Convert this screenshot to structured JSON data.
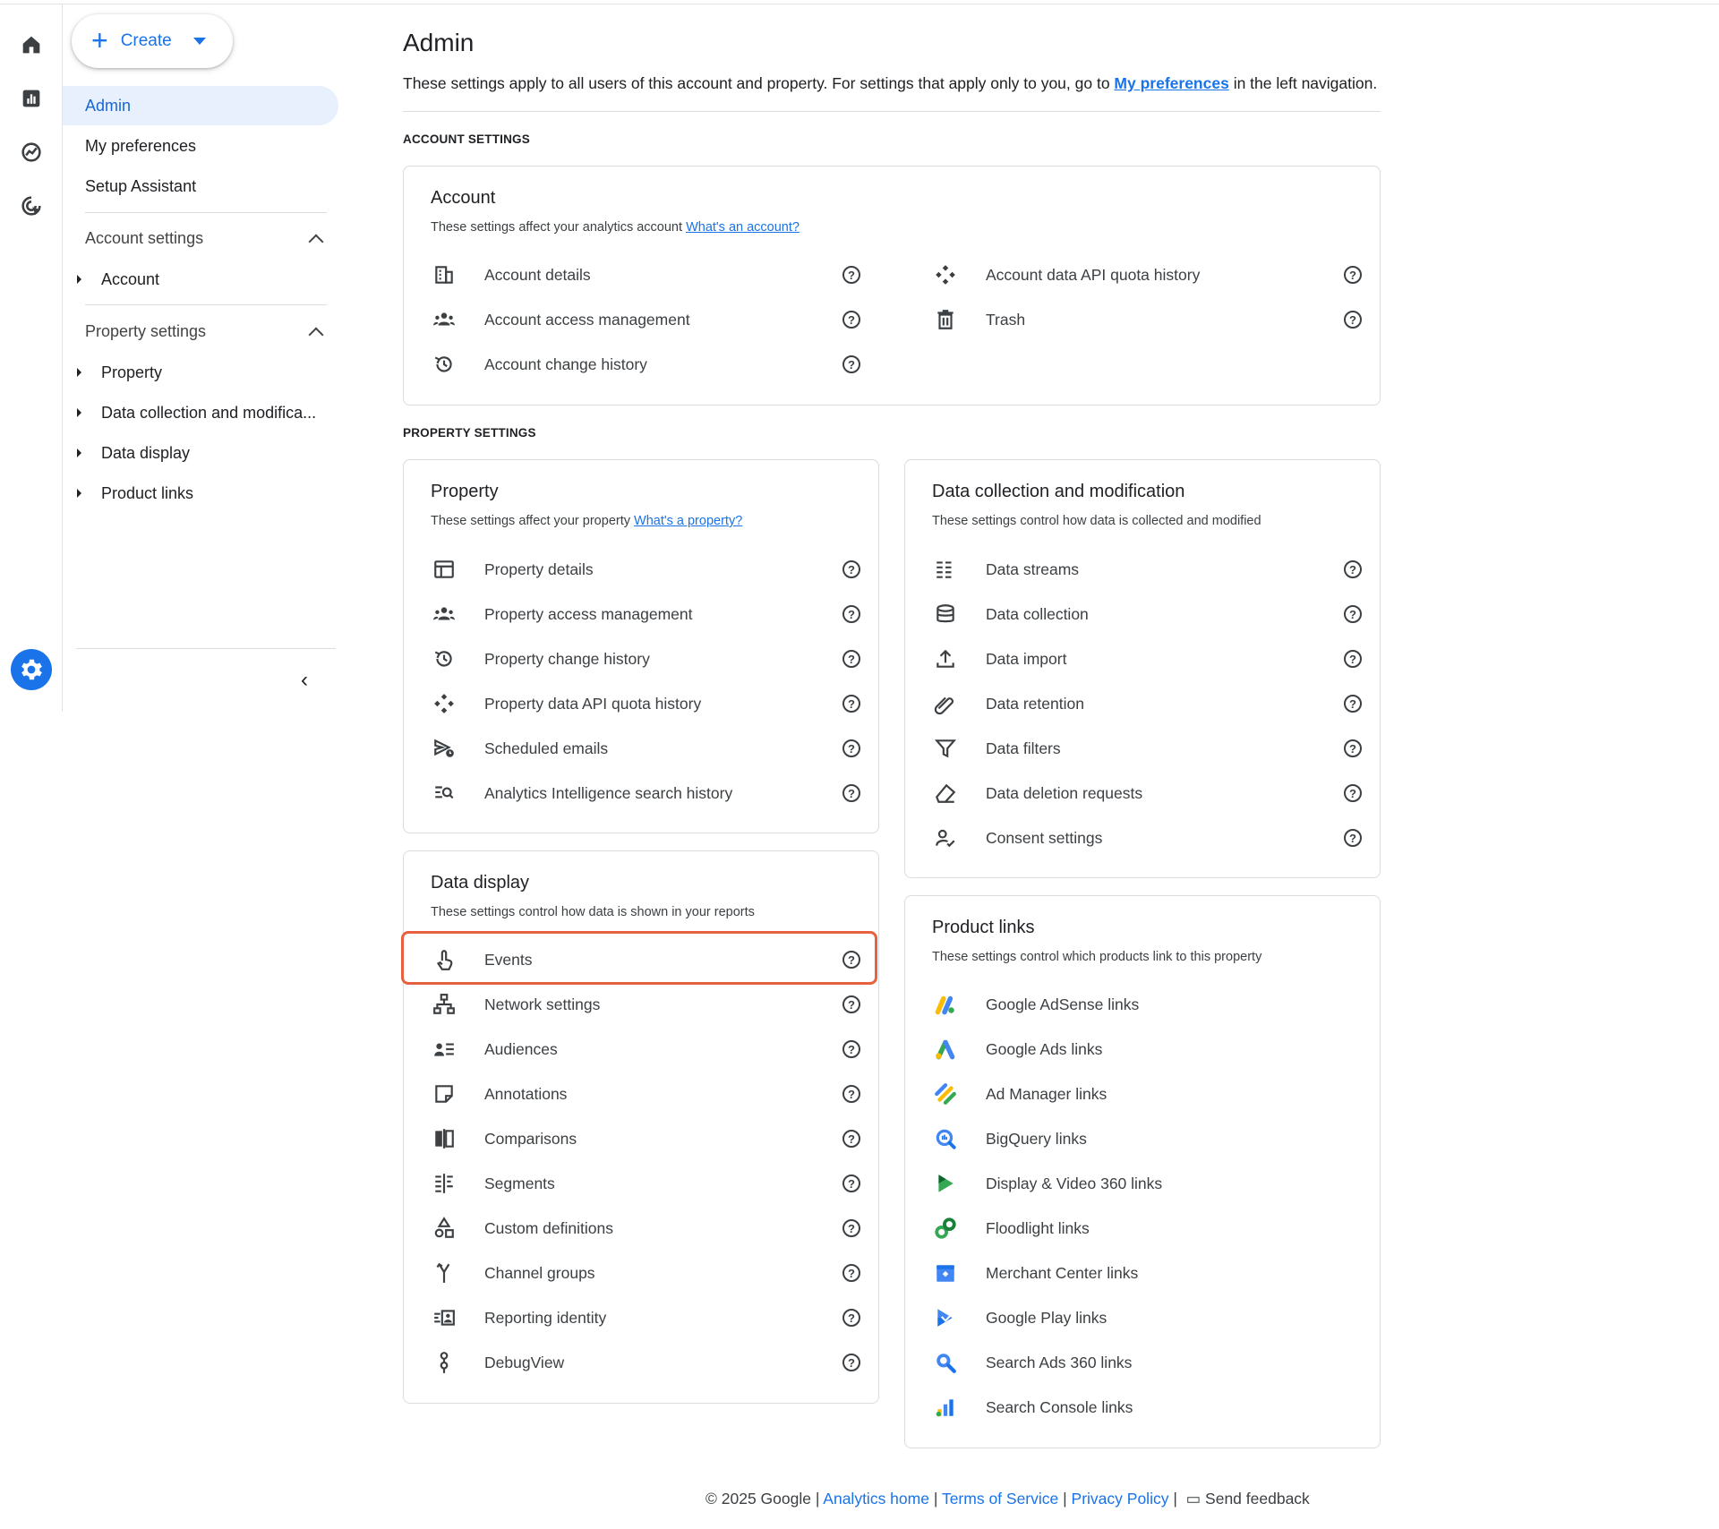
{
  "rail": {
    "icons": [
      "home-icon",
      "reports-icon",
      "explore-icon",
      "advertising-icon"
    ],
    "admin_icon": "gear-icon"
  },
  "create": {
    "label": "Create"
  },
  "nav": {
    "top_items": [
      "Admin",
      "My preferences",
      "Setup Assistant"
    ],
    "account_section": "Account settings",
    "account_items": [
      "Account"
    ],
    "property_section": "Property settings",
    "property_items": [
      "Property",
      "Data collection and modifica...",
      "Data display",
      "Product links"
    ]
  },
  "main": {
    "title": "Admin",
    "intro_before": "These settings apply to all users of this account and property. For settings that apply only to you, go to ",
    "intro_link": "My preferences",
    "intro_after": " in the left navigation.",
    "account_settings_label": "ACCOUNT SETTINGS",
    "property_settings_label": "PROPERTY SETTINGS"
  },
  "account_card": {
    "title": "Account",
    "subtitle": "These settings affect your analytics account ",
    "subtitle_link": "What's an account?",
    "left_items": [
      {
        "icon": "building-icon",
        "label": "Account details"
      },
      {
        "icon": "people-icon",
        "label": "Account access management"
      },
      {
        "icon": "history-icon",
        "label": "Account change history"
      }
    ],
    "right_items": [
      {
        "icon": "api-quota-icon",
        "label": "Account data API quota history"
      },
      {
        "icon": "trash-icon",
        "label": "Trash"
      }
    ]
  },
  "property_card": {
    "title": "Property",
    "subtitle": "These settings affect your property ",
    "subtitle_link": "What's a property?",
    "items": [
      {
        "icon": "property-details-icon",
        "label": "Property details"
      },
      {
        "icon": "people-icon",
        "label": "Property access management"
      },
      {
        "icon": "history-icon",
        "label": "Property change history"
      },
      {
        "icon": "api-quota-icon",
        "label": "Property data API quota history"
      },
      {
        "icon": "scheduled-email-icon",
        "label": "Scheduled emails"
      },
      {
        "icon": "search-history-icon",
        "label": "Analytics Intelligence search history"
      }
    ]
  },
  "data_collection_card": {
    "title": "Data collection and modification",
    "subtitle": "These settings control how data is collected and modified",
    "items": [
      {
        "icon": "data-streams-icon",
        "label": "Data streams"
      },
      {
        "icon": "database-icon",
        "label": "Data collection"
      },
      {
        "icon": "upload-icon",
        "label": "Data import"
      },
      {
        "icon": "retention-icon",
        "label": "Data retention"
      },
      {
        "icon": "filter-icon",
        "label": "Data filters"
      },
      {
        "icon": "eraser-icon",
        "label": "Data deletion requests"
      },
      {
        "icon": "consent-icon",
        "label": "Consent settings"
      }
    ]
  },
  "data_display_card": {
    "title": "Data display",
    "subtitle": "These settings control how data is shown in your reports",
    "items": [
      {
        "icon": "touch-icon",
        "label": "Events"
      },
      {
        "icon": "network-icon",
        "label": "Network settings"
      },
      {
        "icon": "audience-icon",
        "label": "Audiences"
      },
      {
        "icon": "annotation-icon",
        "label": "Annotations"
      },
      {
        "icon": "comparison-icon",
        "label": "Comparisons"
      },
      {
        "icon": "segment-icon",
        "label": "Segments"
      },
      {
        "icon": "shapes-icon",
        "label": "Custom definitions"
      },
      {
        "icon": "merge-icon",
        "label": "Channel groups"
      },
      {
        "icon": "identity-icon",
        "label": "Reporting identity"
      },
      {
        "icon": "debug-icon",
        "label": "DebugView"
      }
    ]
  },
  "product_links_card": {
    "title": "Product links",
    "subtitle": "These settings control which products link to this property",
    "items": [
      {
        "icon": "adsense-icon",
        "label": "Google AdSense links"
      },
      {
        "icon": "google-ads-icon",
        "label": "Google Ads links"
      },
      {
        "icon": "ad-manager-icon",
        "label": "Ad Manager links"
      },
      {
        "icon": "bigquery-icon",
        "label": "BigQuery links"
      },
      {
        "icon": "dv360-icon",
        "label": "Display & Video 360 links"
      },
      {
        "icon": "floodlight-icon",
        "label": "Floodlight links"
      },
      {
        "icon": "merchant-center-icon",
        "label": "Merchant Center links"
      },
      {
        "icon": "google-play-icon",
        "label": "Google Play links"
      },
      {
        "icon": "search-ads-360-icon",
        "label": "Search Ads 360 links"
      },
      {
        "icon": "search-console-icon",
        "label": "Search Console links"
      }
    ]
  },
  "help_glyph": "?",
  "footer": {
    "copyright": "© 2025 Google |",
    "links": [
      "Analytics home",
      "Terms of Service",
      "Privacy Policy"
    ],
    "separator": "|",
    "feedback": "Send feedback"
  },
  "colors": {
    "accent": "#1a73e8",
    "highlight": "#e8613f",
    "active_nav_bg": "#e8f0fe"
  }
}
